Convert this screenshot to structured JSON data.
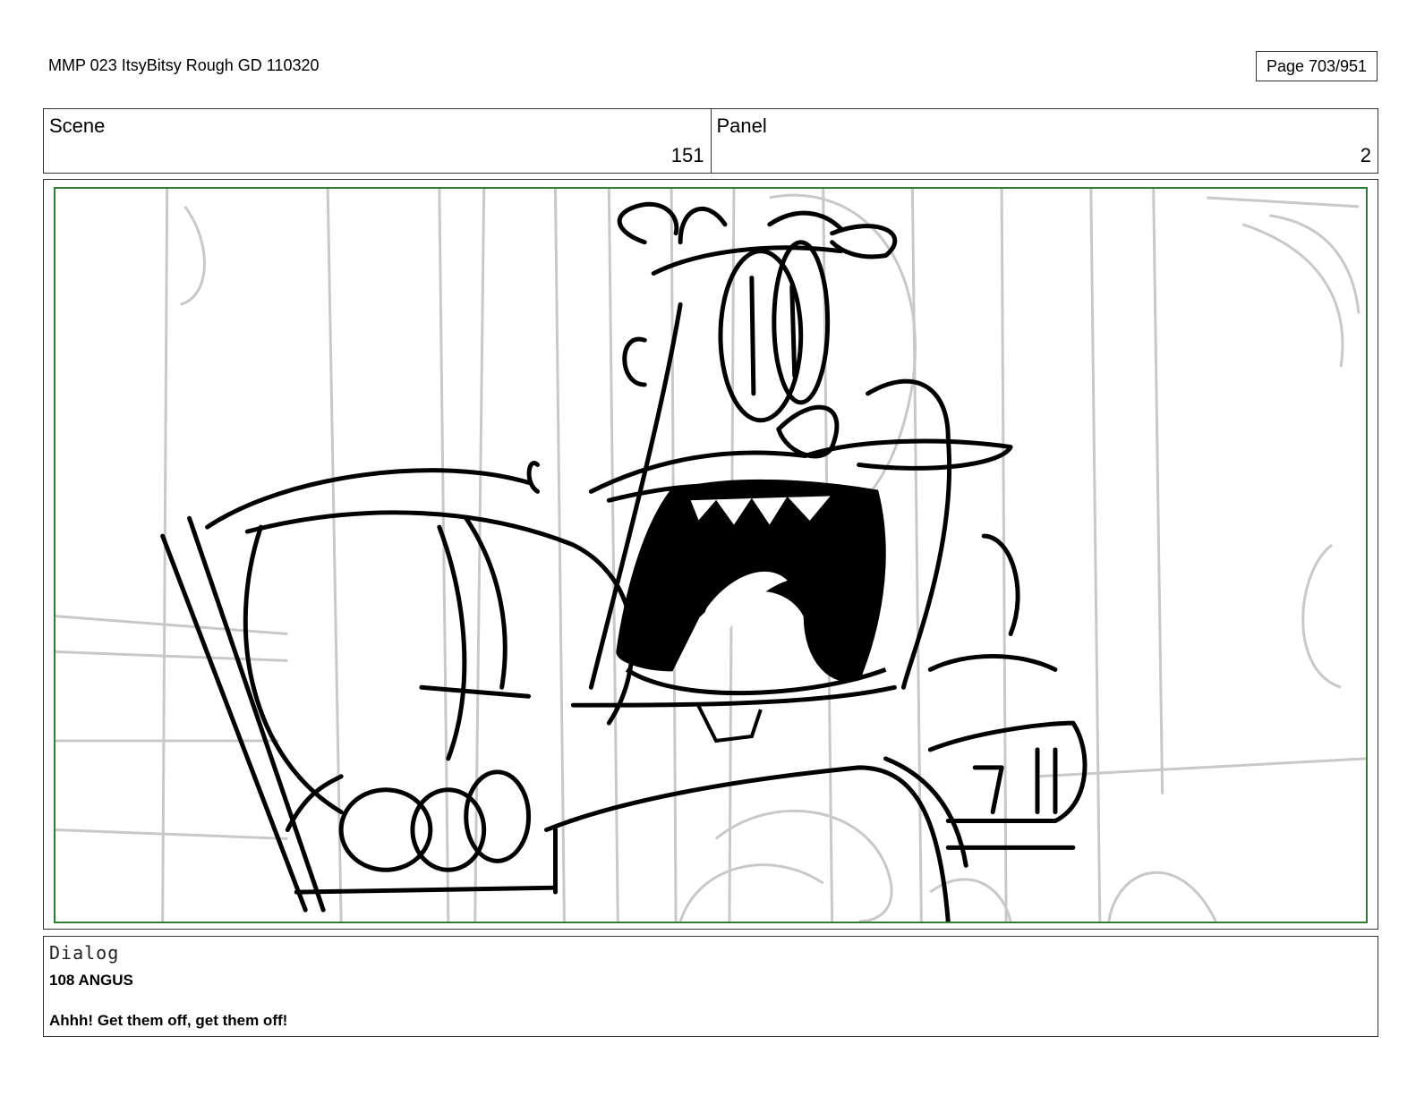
{
  "document": {
    "title": "MMP 023 ItsyBitsy Rough GD 110320",
    "page_label": "Page 703/951"
  },
  "header": {
    "scene_label": "Scene",
    "scene_value": "151",
    "panel_label": "Panel",
    "panel_value": "2"
  },
  "panel_image": {
    "description_icon": "storyboard-sketch-icon",
    "safe_area_color": "#2e7d32"
  },
  "dialog": {
    "label": "Dialog",
    "speaker": "108 ANGUS",
    "line": "Ahhh! Get them off, get them off!"
  }
}
